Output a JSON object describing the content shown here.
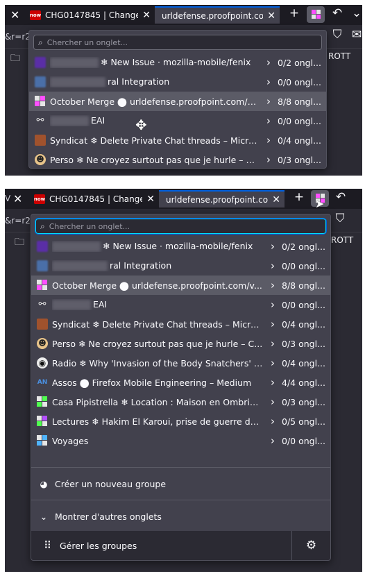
{
  "browser": {
    "tabs": [
      {
        "title": "CHG0147845 | Change R",
        "favicon_text": "now"
      },
      {
        "title": "urldefense.proofpoint.com/"
      }
    ],
    "url_fragment": "&r=r2",
    "bookmark_label": "ROTT"
  },
  "panel": {
    "search_placeholder": "Chercher un onglet...",
    "groups": [
      {
        "label": "❄ New Issue · mozilla-mobile/fenix",
        "count": "0/2 ongl...",
        "icon": "purple-blurred-icon"
      },
      {
        "label": "ral Integration",
        "count": "0/0 ongl...",
        "icon": "blue-blurred-icon"
      },
      {
        "label": "October Merge ⬤ urldefense.proofpoint.com/v...",
        "count": "8/8 ongl...",
        "icon": "colored-grid-icon",
        "selected": true
      },
      {
        "label": "EAI",
        "label2": "",
        "count": "0/0 ongl...",
        "icon": "network-icon"
      },
      {
        "label": "Syndicat ❄ Delete Private Chat threads – Micros...",
        "count": "0/4 ongl...",
        "icon": "brown-avatar-icon"
      },
      {
        "label": "Perso ❄ Ne croyez surtout pas que je hurle – C...",
        "count": "0/3 ongl...",
        "icon": "cartoon-face-icon"
      },
      {
        "label": "Radio ❄ Why 'Invasion of the Body Snatchers' St...",
        "count": "0/4 ongl...",
        "icon": "radio-icon"
      },
      {
        "label": "Assos ⬤ Firefox Mobile Engineering – Medium",
        "count": "4/4 ongl...",
        "icon": "assos-icon"
      },
      {
        "label": "Casa Pipistrella ❄ Location : Maison en Ombrie ...",
        "count": "0/3 ongl...",
        "icon": "green-grid-icon"
      },
      {
        "label": "Lectures ❄ Hakim El Karoui, prise de guerre des...",
        "count": "0/5 ongl...",
        "icon": "purple-grid-icon"
      },
      {
        "label": "Voyages",
        "count": "0/0 ongl...",
        "icon": "blue-grid-icon"
      }
    ],
    "create_group": "Créer un nouveau groupe",
    "show_more": "Montrer d'autres onglets",
    "manage_groups": "Gérer les groupes"
  },
  "colors": {
    "accent": "#0a84ff",
    "panel_bg": "#42414d",
    "focus": "#00ddff"
  }
}
